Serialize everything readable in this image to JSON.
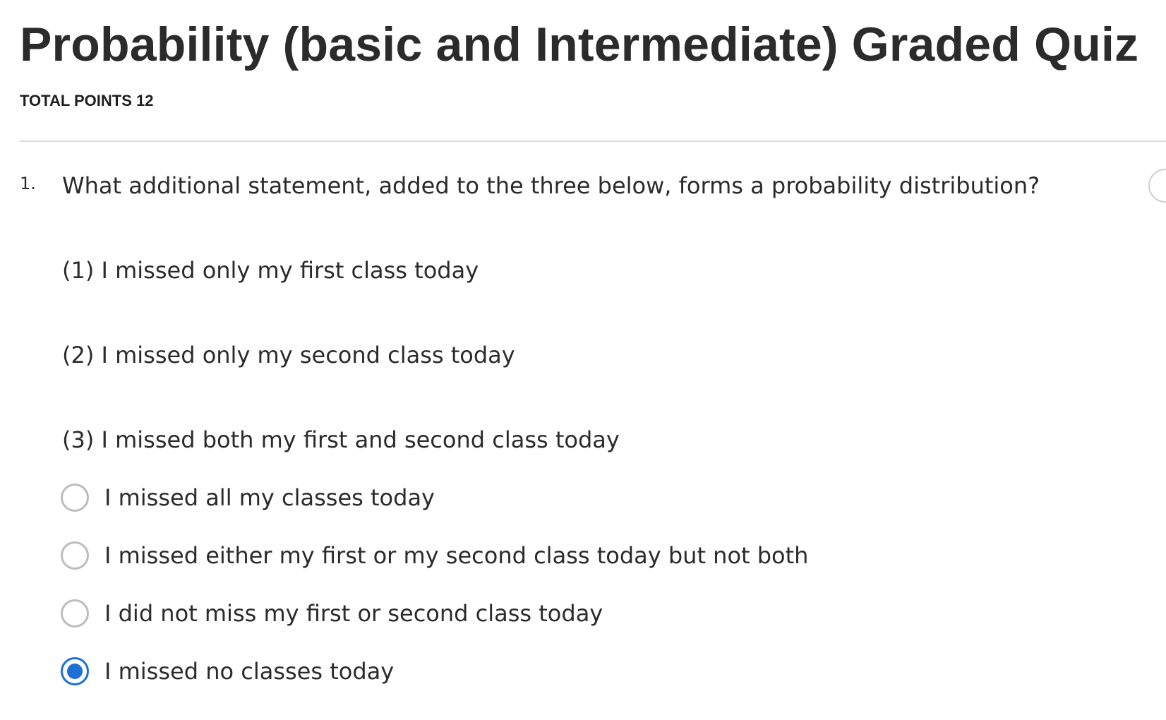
{
  "quiz": {
    "title": "Probability (basic and Intermediate) Graded Quiz",
    "total_points_label": "TOTAL POINTS 12"
  },
  "question": {
    "number": "1.",
    "prompt": "What additional statement, added to the three below, forms a probability distribution?",
    "statements": [
      "(1) I missed only my first class today",
      "(2) I missed only my second class today",
      "(3) I missed both my first and second class today"
    ],
    "options": [
      {
        "label": "I missed all my classes today",
        "selected": false
      },
      {
        "label": "I missed either my first or my second class today but not both",
        "selected": false
      },
      {
        "label": "I did not miss my first or second class today",
        "selected": false
      },
      {
        "label": "I missed no classes today",
        "selected": true
      }
    ]
  },
  "colors": {
    "text": "#2b2b2b",
    "accent": "#1f6fd6",
    "divider": "#dadada",
    "radio_border": "#bdbdbd"
  }
}
